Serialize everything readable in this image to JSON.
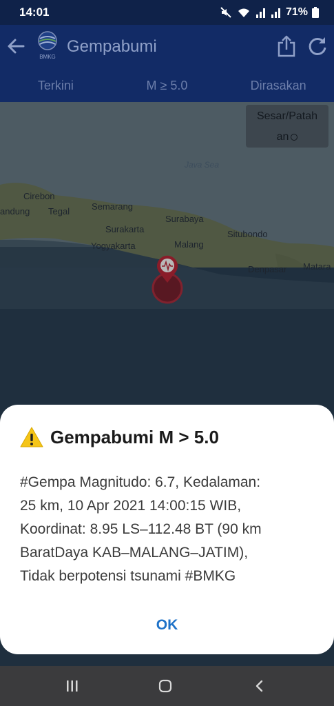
{
  "status_bar": {
    "time": "14:01",
    "battery": "71%",
    "icons": [
      "mute-icon",
      "wifi-icon",
      "signal-icon",
      "signal-icon",
      "battery-icon"
    ]
  },
  "app_bar": {
    "title": "Gempabumi",
    "logo_text": "BMKG",
    "icons": [
      "back-arrow-icon",
      "bmkg-logo",
      "share-icon",
      "refresh-icon"
    ]
  },
  "tabs": [
    {
      "label": "Terkini"
    },
    {
      "label": "M ≥ 5.0"
    },
    {
      "label": "Dirasakan"
    }
  ],
  "map": {
    "fault_toggle": {
      "line1": "Sesar/Patah",
      "line2": "an"
    },
    "sea_label": "Java Sea",
    "cities": [
      "Cirebon",
      "andung",
      "Tegal",
      "Semarang",
      "Surakarta",
      "Yogyakarta",
      "Surabaya",
      "Situbondo",
      "Malang",
      "Denpasar",
      "Matara"
    ],
    "marker": "epicenter-marker-icon"
  },
  "dialog": {
    "title": "Gempabumi M > 5.0",
    "title_icon": "warning-icon",
    "body_lines": [
      "#Gempa Magnitudo: 6.7, Kedalaman:",
      "25 km, 10 Apr 2021 14:00:15 WIB,",
      "Koordinat: 8.95 LS–112.48 BT (90 km",
      "BaratDaya KAB–MALANG–JATIM),",
      "Tidak berpotensi tsunami #BMKG"
    ],
    "ok_label": "OK"
  },
  "nav_bar": {
    "icons": [
      "recent-apps-icon",
      "home-icon",
      "back-icon"
    ]
  },
  "colors": {
    "app_bar": "#122b66",
    "status_bar": "#0f2249",
    "ok_accent": "#1e72c8",
    "marker": "#c0283a"
  }
}
